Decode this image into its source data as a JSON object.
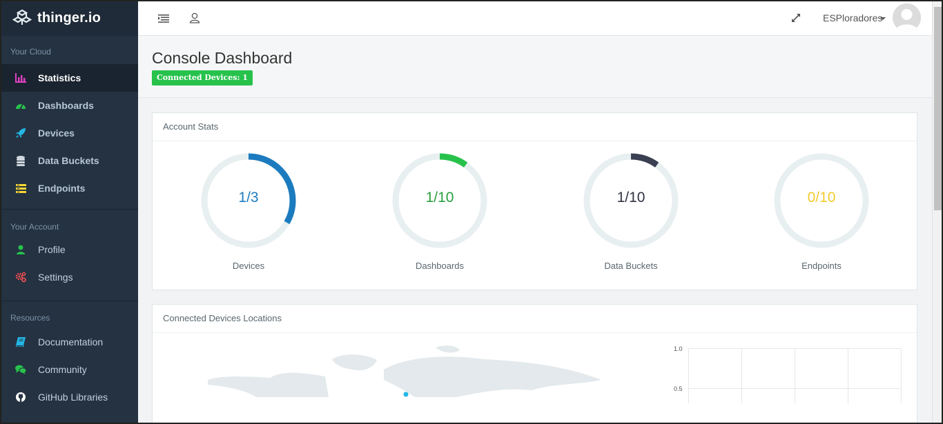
{
  "brand": {
    "name": "thinger.io"
  },
  "sidebar": {
    "sections": [
      {
        "title": "Your Cloud"
      },
      {
        "title": "Your Account"
      },
      {
        "title": "Resources"
      }
    ],
    "items": [
      {
        "label": "Statistics",
        "icon": "bar-chart-icon",
        "color": "#e040c0",
        "active": true
      },
      {
        "label": "Dashboards",
        "icon": "dashboard-icon",
        "color": "#27c24c"
      },
      {
        "label": "Devices",
        "icon": "rocket-icon",
        "color": "#23b7e5"
      },
      {
        "label": "Data Buckets",
        "icon": "database-icon",
        "color": "#d0d7de"
      },
      {
        "label": "Endpoints",
        "icon": "endpoints-icon",
        "color": "#fad733"
      },
      {
        "label": "Profile",
        "icon": "user-icon",
        "color": "#27c24c"
      },
      {
        "label": "Settings",
        "icon": "cogs-icon",
        "color": "#f05050"
      },
      {
        "label": "Documentation",
        "icon": "book-icon",
        "color": "#23b7e5"
      },
      {
        "label": "Community",
        "icon": "comments-icon",
        "color": "#27c24c"
      },
      {
        "label": "GitHub Libraries",
        "icon": "github-icon",
        "color": "#ffffff"
      }
    ]
  },
  "topbar": {
    "user_name": "ESPloradores"
  },
  "page": {
    "title": "Console Dashboard",
    "badge": "Connected Devices: 1"
  },
  "account_stats": {
    "title": "Account Stats",
    "stats": [
      {
        "value": "1/3",
        "label": "Devices",
        "fraction": 0.333,
        "color": "#1c7bbf"
      },
      {
        "value": "1/10",
        "label": "Dashboards",
        "fraction": 0.1,
        "color": "#27c24c"
      },
      {
        "value": "1/10",
        "label": "Data Buckets",
        "fraction": 0.1,
        "color": "#3a3f51"
      },
      {
        "value": "0/10",
        "label": "Endpoints",
        "fraction": 0.0,
        "color": "#fad733"
      }
    ]
  },
  "locations": {
    "title": "Connected Devices Locations",
    "y_ticks": [
      "1.0",
      "0.5"
    ]
  }
}
